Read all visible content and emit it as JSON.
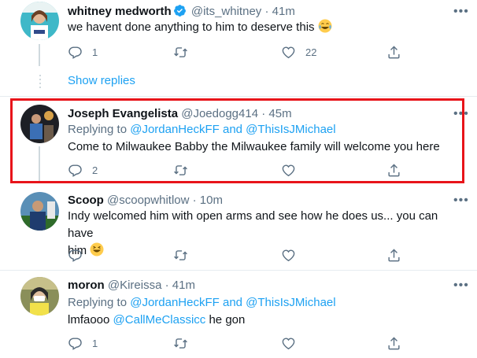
{
  "tweets": [
    {
      "name": "whitney medworth",
      "handle": "@its_whitney",
      "time": "41m",
      "text": "we havent done anything to him to deserve this",
      "emoji": "laughing-tears-emoji",
      "reply_count": "1",
      "like_count": "22",
      "verified": true
    },
    {
      "name": "Joseph Evangelista",
      "handle": "@Joedogg414",
      "time": "45m",
      "replying_prefix": "Replying to",
      "replying_to": "@JordanHeckFF and @ThisIsJMichael",
      "text": "Come to Milwaukee Babby the Milwaukee family will welcome you here",
      "reply_count": "2",
      "like_count": ""
    },
    {
      "name": "Scoop",
      "handle": "@scoopwhitlow",
      "time": "10m",
      "text_line1": "Indy welcomed him with open arms and see how he does us... you can have",
      "text_line2": "him",
      "emoji": "grinning-squint-emoji",
      "reply_count": "",
      "like_count": ""
    },
    {
      "name": "moron",
      "handle": "@Kireissa",
      "time": "41m",
      "replying_prefix": "Replying to",
      "replying_to": "@JordanHeckFF and @ThisIsJMichael",
      "text_prefix": "lmfaooo",
      "mention": "@CallMeClassicc",
      "text_suffix": "he gon",
      "reply_count": "1",
      "like_count": ""
    }
  ],
  "show_replies": "Show replies",
  "separator": "·",
  "more_glyph": "•••",
  "colors": {
    "accent": "#1da1f2",
    "muted": "#5b7083",
    "highlight": "#e8141a"
  }
}
